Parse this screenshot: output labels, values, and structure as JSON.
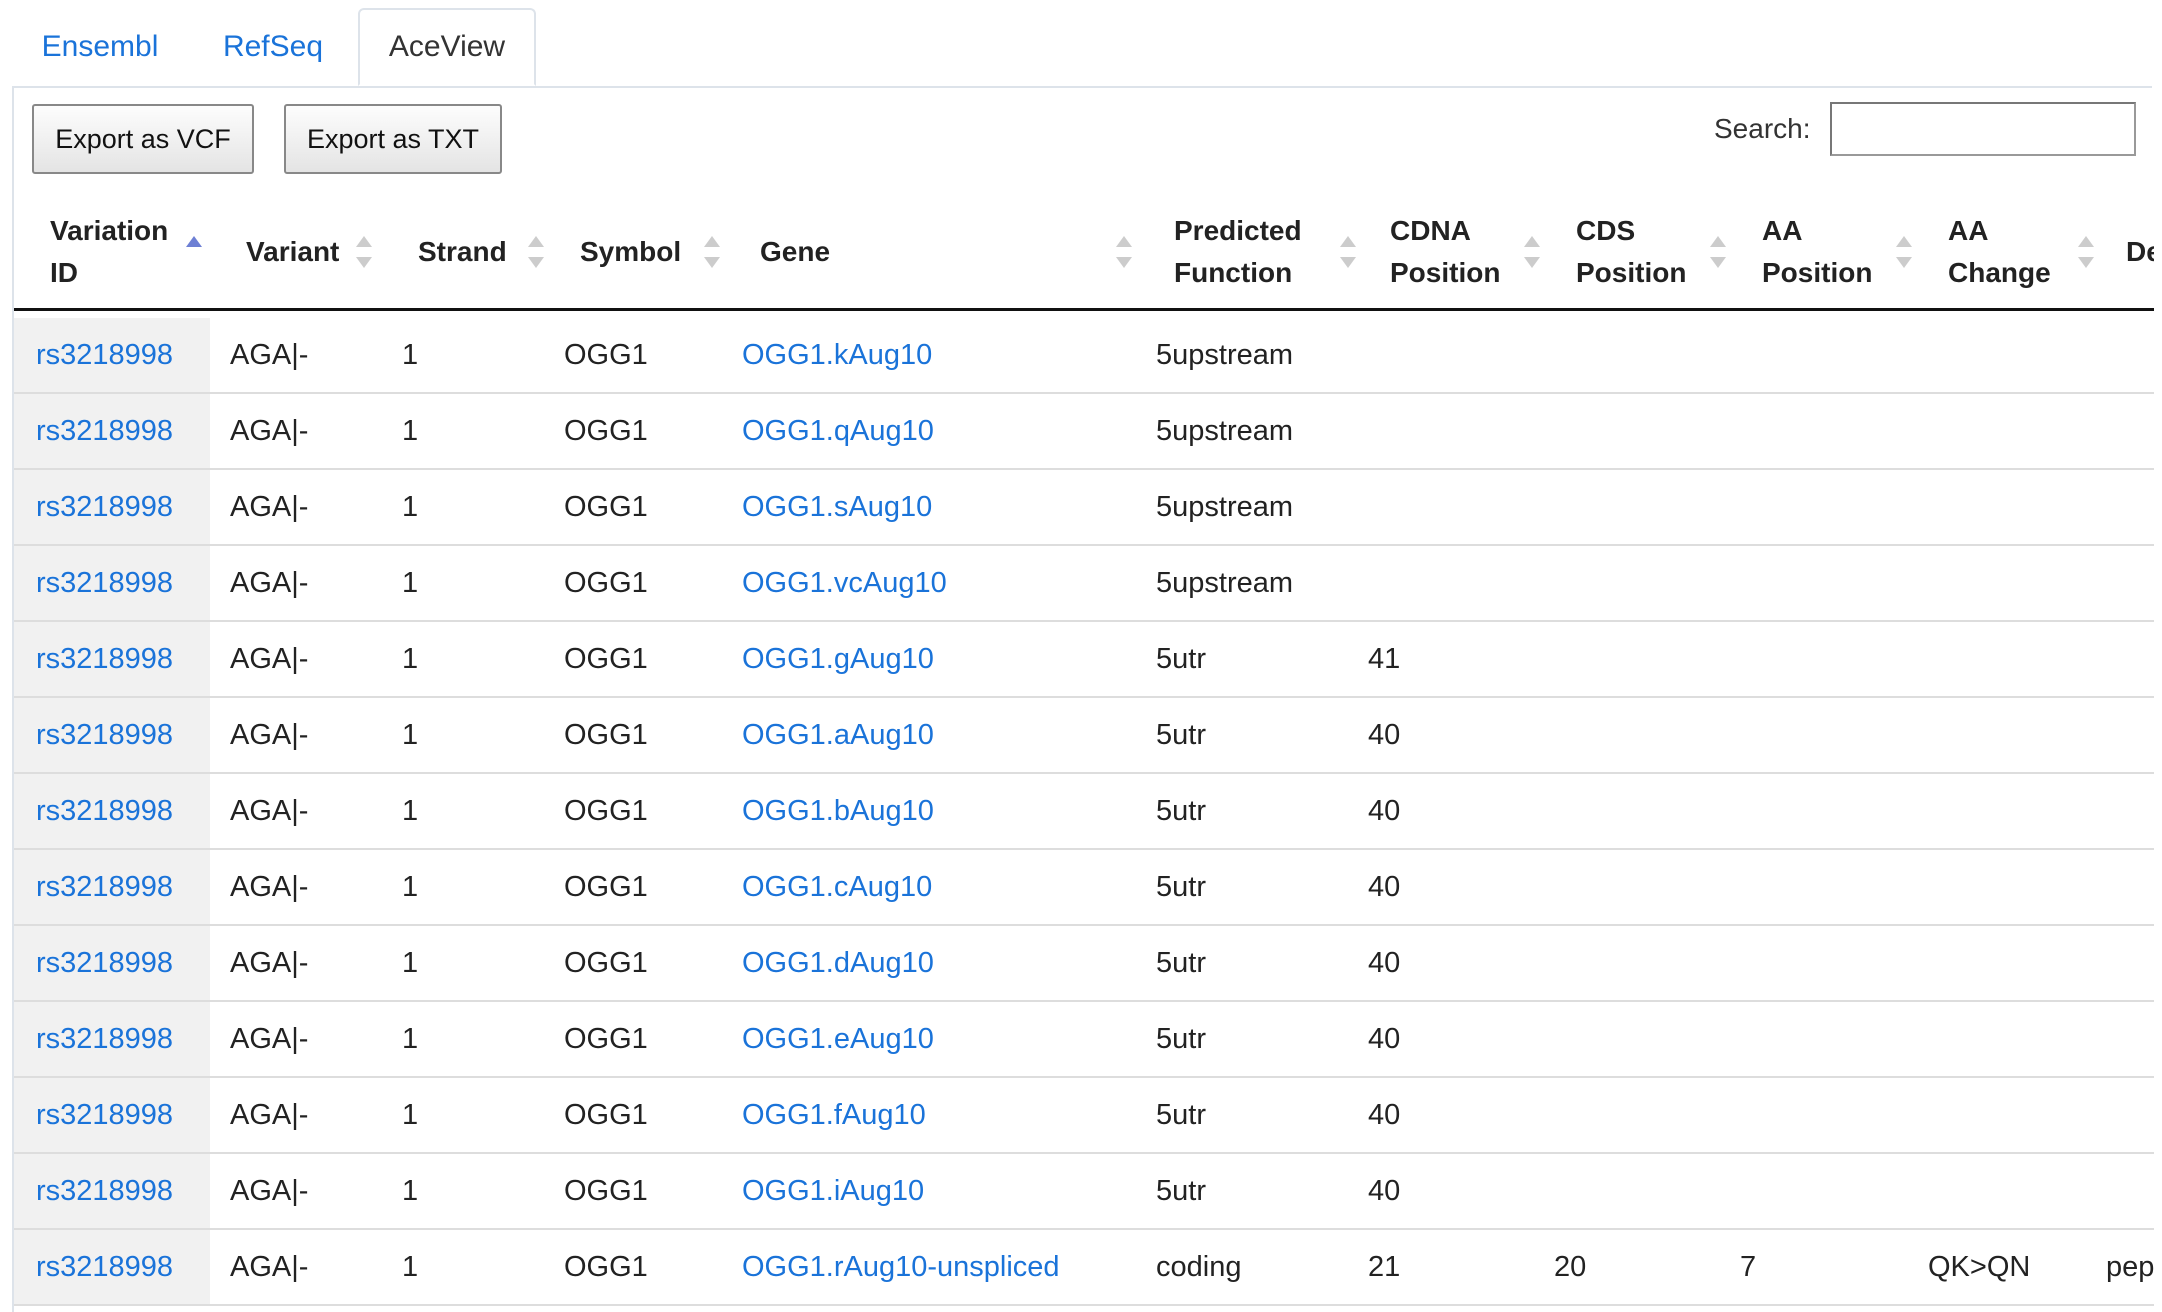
{
  "tabs": [
    {
      "label": "Ensembl"
    },
    {
      "label": "RefSeq"
    },
    {
      "label": "AceView"
    }
  ],
  "toolbar": {
    "export_vcf": "Export as VCF",
    "export_txt": "Export as TXT",
    "search_label": "Search:",
    "search_value": ""
  },
  "columns": [
    {
      "label": "Variation\nID",
      "sort": "asc"
    },
    {
      "label": "Variant",
      "sort": "none"
    },
    {
      "label": "Strand",
      "sort": "none"
    },
    {
      "label": "Symbol",
      "sort": "none"
    },
    {
      "label": "Gene",
      "sort": "none"
    },
    {
      "label": "Predicted\nFunction",
      "sort": "none"
    },
    {
      "label": "CDNA\nPosition",
      "sort": "none"
    },
    {
      "label": "CDS\nPosition",
      "sort": "none"
    },
    {
      "label": "AA\nPosition",
      "sort": "none"
    },
    {
      "label": "AA\nChange",
      "sort": "none"
    },
    {
      "label": "De",
      "sort": "none"
    }
  ],
  "rows": [
    {
      "id": "rs3218998",
      "variant": "AGA|-",
      "strand": "1",
      "symbol": "OGG1",
      "gene": "OGG1.kAug10",
      "function": "5upstream",
      "cdna": "",
      "cds": "",
      "aa_pos": "",
      "aa_change": "",
      "desc": ""
    },
    {
      "id": "rs3218998",
      "variant": "AGA|-",
      "strand": "1",
      "symbol": "OGG1",
      "gene": "OGG1.qAug10",
      "function": "5upstream",
      "cdna": "",
      "cds": "",
      "aa_pos": "",
      "aa_change": "",
      "desc": ""
    },
    {
      "id": "rs3218998",
      "variant": "AGA|-",
      "strand": "1",
      "symbol": "OGG1",
      "gene": "OGG1.sAug10",
      "function": "5upstream",
      "cdna": "",
      "cds": "",
      "aa_pos": "",
      "aa_change": "",
      "desc": ""
    },
    {
      "id": "rs3218998",
      "variant": "AGA|-",
      "strand": "1",
      "symbol": "OGG1",
      "gene": "OGG1.vcAug10",
      "function": "5upstream",
      "cdna": "",
      "cds": "",
      "aa_pos": "",
      "aa_change": "",
      "desc": ""
    },
    {
      "id": "rs3218998",
      "variant": "AGA|-",
      "strand": "1",
      "symbol": "OGG1",
      "gene": "OGG1.gAug10",
      "function": "5utr",
      "cdna": "41",
      "cds": "",
      "aa_pos": "",
      "aa_change": "",
      "desc": ""
    },
    {
      "id": "rs3218998",
      "variant": "AGA|-",
      "strand": "1",
      "symbol": "OGG1",
      "gene": "OGG1.aAug10",
      "function": "5utr",
      "cdna": "40",
      "cds": "",
      "aa_pos": "",
      "aa_change": "",
      "desc": ""
    },
    {
      "id": "rs3218998",
      "variant": "AGA|-",
      "strand": "1",
      "symbol": "OGG1",
      "gene": "OGG1.bAug10",
      "function": "5utr",
      "cdna": "40",
      "cds": "",
      "aa_pos": "",
      "aa_change": "",
      "desc": ""
    },
    {
      "id": "rs3218998",
      "variant": "AGA|-",
      "strand": "1",
      "symbol": "OGG1",
      "gene": "OGG1.cAug10",
      "function": "5utr",
      "cdna": "40",
      "cds": "",
      "aa_pos": "",
      "aa_change": "",
      "desc": ""
    },
    {
      "id": "rs3218998",
      "variant": "AGA|-",
      "strand": "1",
      "symbol": "OGG1",
      "gene": "OGG1.dAug10",
      "function": "5utr",
      "cdna": "40",
      "cds": "",
      "aa_pos": "",
      "aa_change": "",
      "desc": ""
    },
    {
      "id": "rs3218998",
      "variant": "AGA|-",
      "strand": "1",
      "symbol": "OGG1",
      "gene": "OGG1.eAug10",
      "function": "5utr",
      "cdna": "40",
      "cds": "",
      "aa_pos": "",
      "aa_change": "",
      "desc": ""
    },
    {
      "id": "rs3218998",
      "variant": "AGA|-",
      "strand": "1",
      "symbol": "OGG1",
      "gene": "OGG1.fAug10",
      "function": "5utr",
      "cdna": "40",
      "cds": "",
      "aa_pos": "",
      "aa_change": "",
      "desc": ""
    },
    {
      "id": "rs3218998",
      "variant": "AGA|-",
      "strand": "1",
      "symbol": "OGG1",
      "gene": "OGG1.iAug10",
      "function": "5utr",
      "cdna": "40",
      "cds": "",
      "aa_pos": "",
      "aa_change": "",
      "desc": ""
    },
    {
      "id": "rs3218998",
      "variant": "AGA|-",
      "strand": "1",
      "symbol": "OGG1",
      "gene": "OGG1.rAug10-unspliced",
      "function": "coding",
      "cdna": "21",
      "cds": "20",
      "aa_pos": "7",
      "aa_change": "QK>QN",
      "desc": "pep"
    }
  ],
  "colors": {
    "link": "#1a73d9",
    "sort_active": "#6d7fd4",
    "sort_inactive": "#cccccc"
  }
}
